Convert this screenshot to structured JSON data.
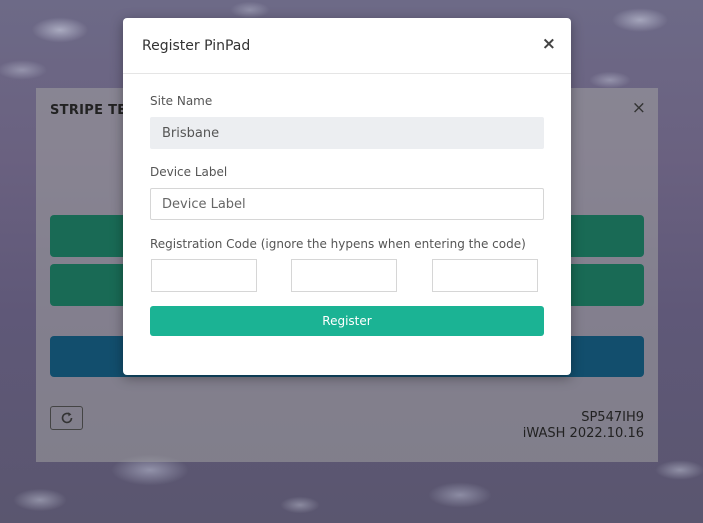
{
  "background_panel": {
    "title": "STRIPE TER",
    "close_glyph": "×",
    "refresh_icon": "refresh-icon",
    "device_id": "SP547IH9",
    "version": "iWASH 2022.10.16"
  },
  "modal": {
    "title": "Register PinPad",
    "close_glyph": "×",
    "site_name": {
      "label": "Site Name",
      "value": "Brisbane"
    },
    "device_label": {
      "label": "Device Label",
      "placeholder": "Device Label",
      "value": ""
    },
    "registration_code": {
      "label": "Registration Code (ignore the hypens when entering the code)",
      "parts": [
        "",
        "",
        ""
      ]
    },
    "register_button": "Register"
  },
  "colors": {
    "primary_green": "#1bb394",
    "dark_green": "#196a55",
    "dark_blue": "#124e6d"
  }
}
